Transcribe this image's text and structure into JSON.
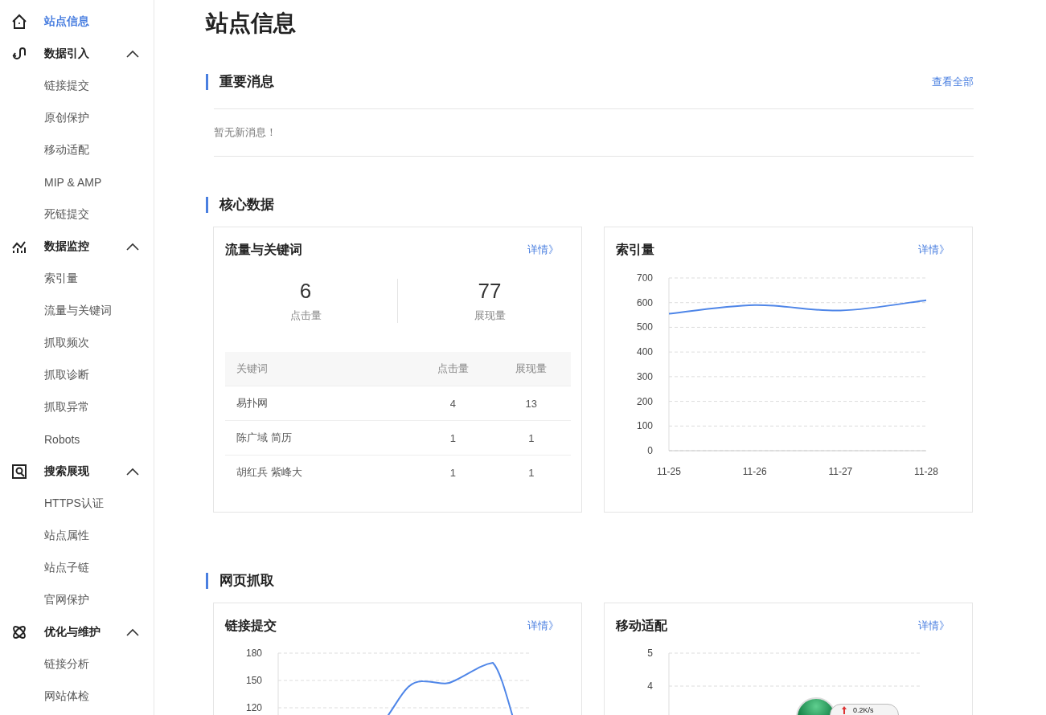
{
  "sidebar": {
    "items": [
      {
        "label": "站点信息",
        "kind": "link",
        "selected": true
      },
      {
        "label": "数据引入",
        "kind": "group",
        "expanded": true,
        "children": [
          {
            "label": "链接提交",
            "selected": false
          },
          {
            "label": "原创保护",
            "selected": false
          },
          {
            "label": "移动适配",
            "selected": false
          },
          {
            "label": "MIP & AMP",
            "selected": false
          },
          {
            "label": "死链提交",
            "selected": false
          }
        ]
      },
      {
        "label": "数据监控",
        "kind": "group",
        "expanded": true,
        "children": [
          {
            "label": "索引量",
            "selected": false
          },
          {
            "label": "流量与关键词",
            "selected": false
          },
          {
            "label": "抓取频次",
            "selected": false
          },
          {
            "label": "抓取诊断",
            "selected": false
          },
          {
            "label": "抓取异常",
            "selected": false
          },
          {
            "label": "Robots",
            "selected": false
          }
        ]
      },
      {
        "label": "搜索展现",
        "kind": "group",
        "expanded": true,
        "children": [
          {
            "label": "HTTPS认证",
            "selected": false
          },
          {
            "label": "站点属性",
            "selected": false
          },
          {
            "label": "站点子链",
            "selected": false
          },
          {
            "label": "官网保护",
            "selected": false
          }
        ]
      },
      {
        "label": "优化与维护",
        "kind": "group",
        "expanded": true,
        "children": [
          {
            "label": "链接分析",
            "selected": false
          },
          {
            "label": "网站体检",
            "selected": false
          }
        ]
      }
    ]
  },
  "page_title": "站点信息",
  "notices": {
    "title": "重要消息",
    "link": "查看全部",
    "message": "暂无新消息！"
  },
  "core": {
    "title": "核心数据",
    "traffic_card": {
      "title": "流量与关键词",
      "link": "详情》",
      "metrics": [
        {
          "value": "6",
          "label": "点击量"
        },
        {
          "value": "77",
          "label": "展现量"
        }
      ],
      "table": {
        "columns": [
          "关键词",
          "点击量",
          "展现量"
        ],
        "rows": [
          [
            "易扑网",
            "4",
            "13"
          ],
          [
            "陈广域 简历",
            "1",
            "1"
          ],
          [
            "胡红兵 紫峰大",
            "1",
            "1"
          ]
        ]
      }
    },
    "index_card": {
      "title": "索引量",
      "link": "详情》",
      "chart_data": {
        "type": "line",
        "categories": [
          "11-25",
          "11-26",
          "11-27",
          "11-28"
        ],
        "series": [
          {
            "color": "#4f86e8",
            "values": [
              555,
              590,
              568,
              610
            ]
          }
        ],
        "grid": true,
        "ylim": [
          0,
          700
        ],
        "yticks": [
          0,
          100,
          200,
          300,
          400,
          500,
          600,
          700
        ]
      }
    }
  },
  "crawl": {
    "title": "网页抓取",
    "cards": [
      {
        "title": "链接提交",
        "link": "详情》",
        "y_ticks": [
          "180",
          "150",
          "120"
        ]
      },
      {
        "title": "移动适配",
        "link": "详情》",
        "y_ticks": [
          "5",
          "4"
        ]
      }
    ]
  },
  "speed_widget": {
    "upload": "0.2K/s"
  }
}
